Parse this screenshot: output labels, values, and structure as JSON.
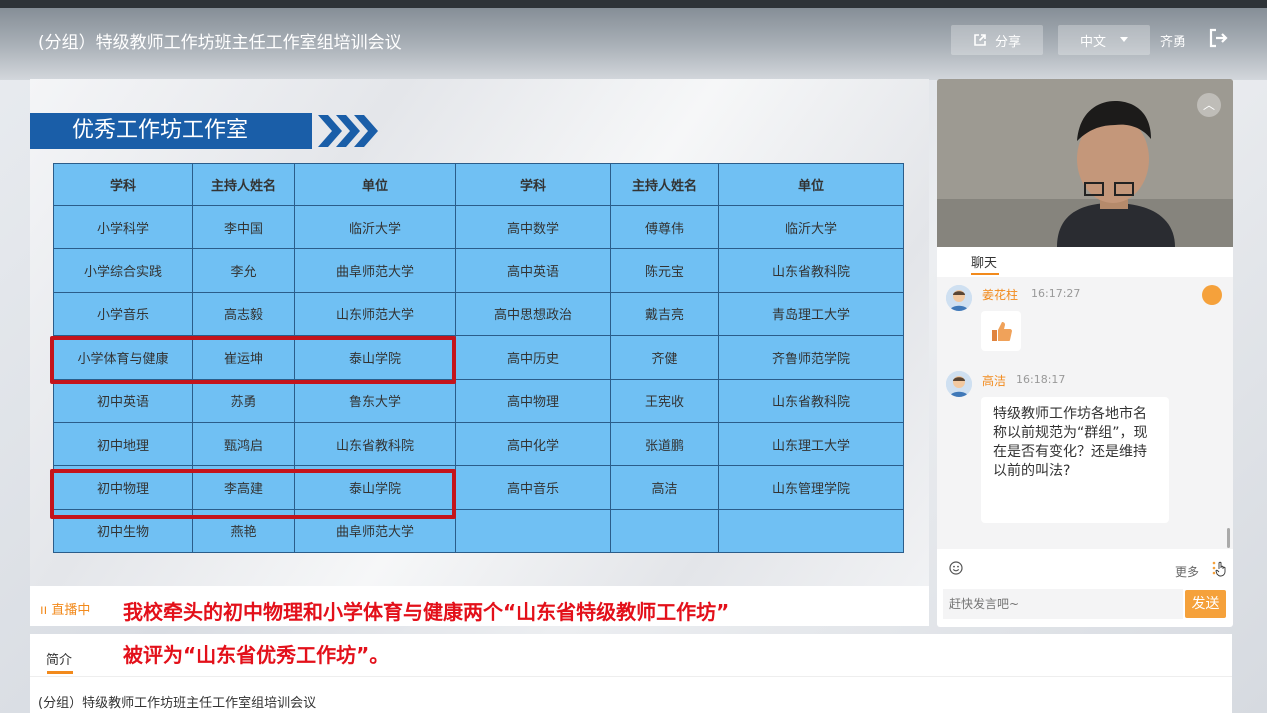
{
  "header": {
    "title": "(分组）特级教师工作坊班主任工作室组培训会议",
    "share_label": "分享",
    "language_label": "中文",
    "username": "齐勇"
  },
  "slide": {
    "heading": "优秀工作坊工作室",
    "table": {
      "headers": [
        "学科",
        "主持人姓名",
        "单位",
        "学科",
        "主持人姓名",
        "单位"
      ],
      "rows": [
        [
          "小学科学",
          "李中国",
          "临沂大学",
          "高中数学",
          "傅尊伟",
          "临沂大学"
        ],
        [
          "小学综合实践",
          "李允",
          "曲阜师范大学",
          "高中英语",
          "陈元宝",
          "山东省教科院"
        ],
        [
          "小学音乐",
          "高志毅",
          "山东师范大学",
          "高中思想政治",
          "戴吉亮",
          "青岛理工大学"
        ],
        [
          "小学体育与健康",
          "崔运坤",
          "泰山学院",
          "高中历史",
          "齐健",
          "齐鲁师范学院"
        ],
        [
          "初中英语",
          "苏勇",
          "鲁东大学",
          "高中物理",
          "王宪收",
          "山东省教科院"
        ],
        [
          "初中地理",
          "甄鸿启",
          "山东省教科院",
          "高中化学",
          "张道鹏",
          "山东理工大学"
        ],
        [
          "初中物理",
          "李高建",
          "泰山学院",
          "高中音乐",
          "高洁",
          "山东管理学院"
        ],
        [
          "初中生物",
          "燕艳",
          "曲阜师范大学",
          "",
          "",
          ""
        ]
      ]
    }
  },
  "live": {
    "status": "直播中",
    "notice_line1": "我校牵头的初中物理和小学体育与健康两个“山东省特级教师工作坊”",
    "notice_line2": "被评为“山东省优秀工作坊”。"
  },
  "intro": {
    "tab_label": "简介",
    "description": "(分组）特级教师工作坊班主任工作室组培训会议"
  },
  "chat": {
    "tab_label": "聊天",
    "messages": [
      {
        "name": "姜花柱",
        "time": "16:17:27",
        "content_icon": "thumbs-up"
      },
      {
        "name": "高洁",
        "time": "16:18:17",
        "text": "特级教师工作坊各地市名称以前规范为“群组”，现在是否有变化？还是维持以前的叫法?"
      }
    ],
    "more_label": "更多",
    "input_placeholder": "赶快发言吧~",
    "send_label": "发送"
  },
  "colors": {
    "accent": "#f28a1c",
    "table_cell": "#70c0f3",
    "title_bar": "#1a5ea8",
    "highlight": "#c4141b",
    "notice": "#e3101a"
  }
}
